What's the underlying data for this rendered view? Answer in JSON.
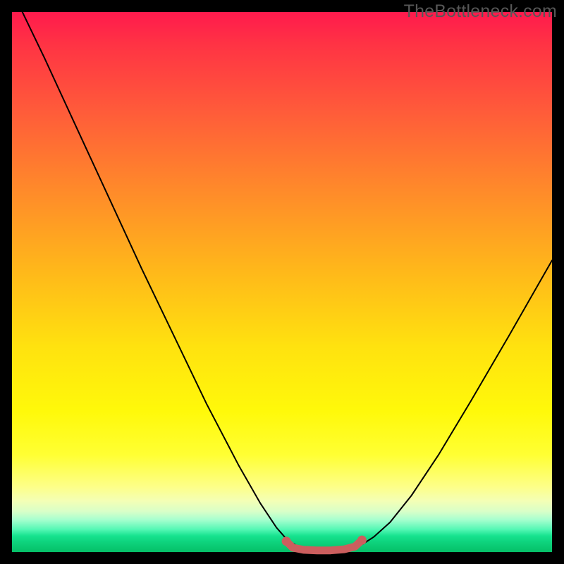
{
  "watermark": "TheBottleneck.com",
  "chart_data": {
    "type": "line",
    "title": "",
    "xlabel": "",
    "ylabel": "",
    "xlim": [
      0,
      1
    ],
    "ylim": [
      0,
      1
    ],
    "series": [
      {
        "name": "curve",
        "color": "#000000",
        "x": [
          0.0,
          0.06,
          0.12,
          0.18,
          0.24,
          0.3,
          0.36,
          0.42,
          0.46,
          0.49,
          0.51,
          0.53,
          0.555,
          0.59,
          0.625,
          0.65,
          0.67,
          0.7,
          0.74,
          0.79,
          0.85,
          0.92,
          1.0
        ],
        "y": [
          1.04,
          0.915,
          0.785,
          0.655,
          0.525,
          0.4,
          0.275,
          0.16,
          0.09,
          0.045,
          0.022,
          0.01,
          0.005,
          0.005,
          0.008,
          0.015,
          0.028,
          0.055,
          0.105,
          0.18,
          0.28,
          0.4,
          0.54
        ]
      },
      {
        "name": "flat-region-marker",
        "color": "#d16060",
        "x": [
          0.508,
          0.52,
          0.54,
          0.565,
          0.59,
          0.615,
          0.635,
          0.648
        ],
        "y": [
          0.02,
          0.008,
          0.004,
          0.003,
          0.003,
          0.005,
          0.01,
          0.022
        ]
      }
    ],
    "marker_endpoints": {
      "left": {
        "x": 0.508,
        "y": 0.02
      },
      "right": {
        "x": 0.648,
        "y": 0.022
      }
    }
  }
}
